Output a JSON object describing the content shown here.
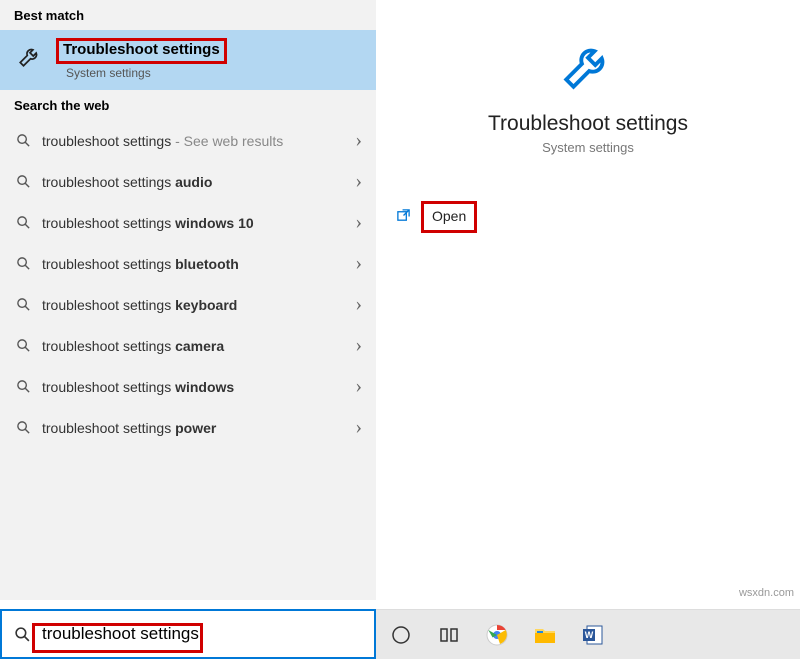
{
  "left": {
    "best_match_header": "Best match",
    "best_match": {
      "title": "Troubleshoot settings",
      "subtitle": "System settings"
    },
    "web_header": "Search the web",
    "web_hint": " - See web results",
    "items": [
      {
        "prefix": "troubleshoot settings",
        "bold": ""
      },
      {
        "prefix": "troubleshoot settings ",
        "bold": "audio"
      },
      {
        "prefix": "troubleshoot settings ",
        "bold": "windows 10"
      },
      {
        "prefix": "troubleshoot settings ",
        "bold": "bluetooth"
      },
      {
        "prefix": "troubleshoot settings ",
        "bold": "keyboard"
      },
      {
        "prefix": "troubleshoot settings ",
        "bold": "camera"
      },
      {
        "prefix": "troubleshoot settings ",
        "bold": "windows"
      },
      {
        "prefix": "troubleshoot settings ",
        "bold": "power"
      }
    ]
  },
  "right": {
    "title": "Troubleshoot settings",
    "subtitle": "System settings",
    "open": "Open"
  },
  "search": {
    "value": "troubleshoot settings"
  },
  "watermark": "wsxdn.com",
  "colors": {
    "accent": "#0078d7",
    "highlight": "#b3d7f2",
    "annotation": "#d00000"
  }
}
